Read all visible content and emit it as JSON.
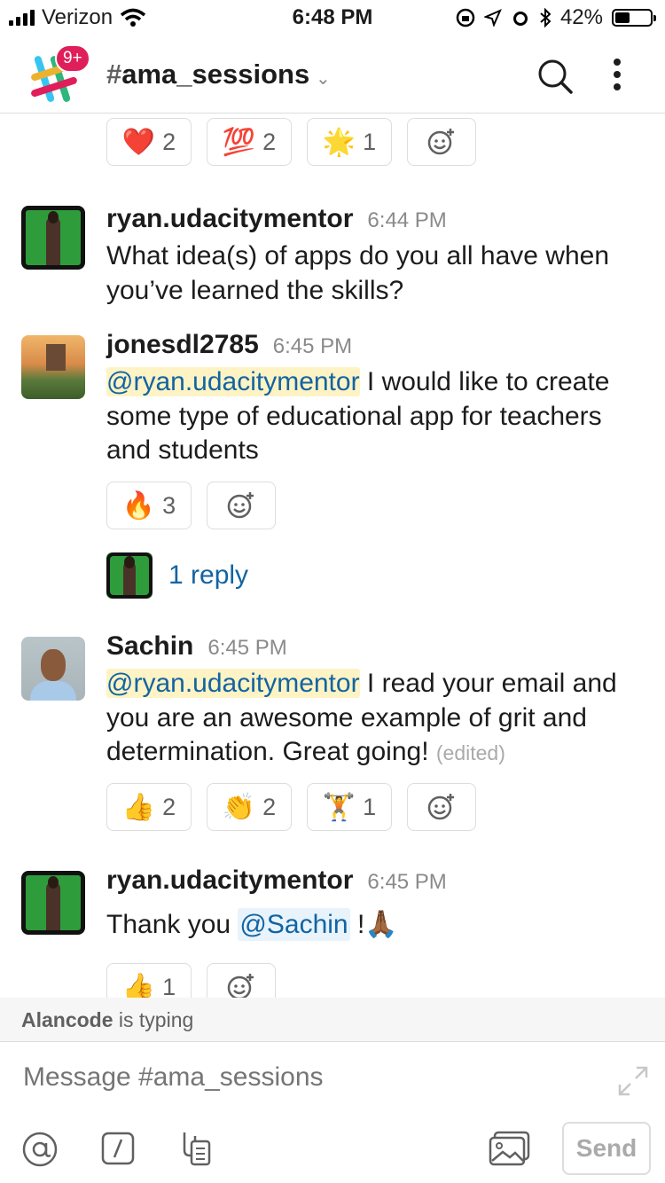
{
  "status": {
    "carrier": "Verizon",
    "time": "6:48 PM",
    "battery": "42%"
  },
  "header": {
    "badge": "9+",
    "channel_hash": "#",
    "channel_name": "ama_sessions"
  },
  "top_reactions": [
    {
      "emoji": "❤️",
      "count": "2"
    },
    {
      "emoji": "💯",
      "count": "2"
    },
    {
      "emoji": "🌟",
      "count": "1"
    }
  ],
  "messages": [
    {
      "author": "ryan.udacitymentor",
      "time": "6:44 PM",
      "text": "What idea(s) of apps do you all have when you’ve learned the skills?"
    },
    {
      "author": "jonesdl2785",
      "time": "6:45 PM",
      "mention": "@ryan.udacitymentor",
      "text": " I would like to create some type of educational app for teachers and students",
      "reactions": [
        {
          "emoji": "🔥",
          "count": "3"
        }
      ],
      "thread": "1 reply"
    },
    {
      "author": "Sachin",
      "time": "6:45 PM",
      "mention": "@ryan.udacitymentor",
      "text": " I read your email and you are an awesome example of grit and determination. Great going! ",
      "edited": "(edited)",
      "reactions": [
        {
          "emoji": "👍",
          "count": "2"
        },
        {
          "emoji": "👏",
          "count": "2"
        },
        {
          "emoji": "🏋️",
          "count": "1"
        }
      ]
    },
    {
      "author": "ryan.udacitymentor",
      "time": "6:45 PM",
      "text_before": "Thank you ",
      "mention": "@Sachin",
      "text_after": " !🙏🏾",
      "reactions": [
        {
          "emoji": "👍",
          "count": "1"
        }
      ]
    }
  ],
  "typing": {
    "user": "Alancode",
    "text": " is typing"
  },
  "composer": {
    "placeholder": "Message #ama_sessions",
    "send_label": "Send"
  },
  "colors": {
    "link": "#1264a3",
    "mention_bg": "#fdf3c4",
    "badge": "#e01e5a"
  }
}
